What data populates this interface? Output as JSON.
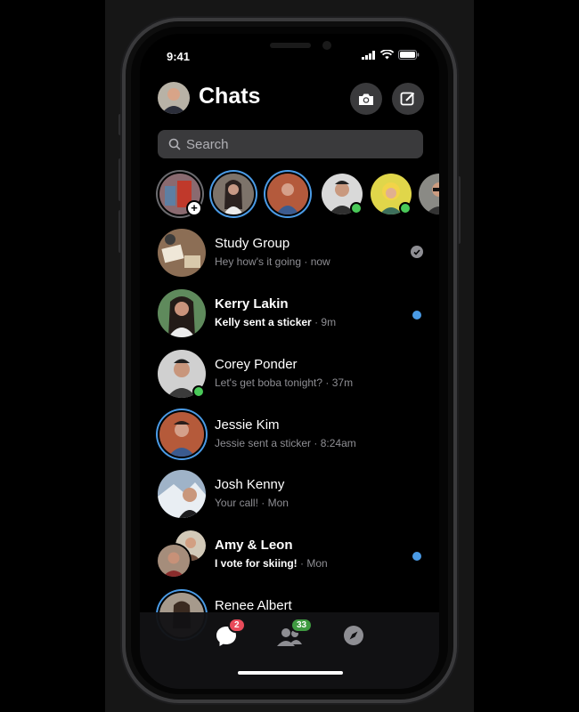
{
  "status_bar": {
    "time": "9:41"
  },
  "header": {
    "title": "Chats",
    "camera_icon": "camera-icon",
    "compose_icon": "compose-icon"
  },
  "search": {
    "placeholder": "Search"
  },
  "stories": [
    {
      "kind": "add-story",
      "ring": "none"
    },
    {
      "kind": "story",
      "ring": "blue"
    },
    {
      "kind": "story",
      "ring": "blue"
    },
    {
      "kind": "active",
      "online": true
    },
    {
      "kind": "active",
      "online": true
    },
    {
      "kind": "active",
      "online": false
    }
  ],
  "chats": [
    {
      "name": "Study Group",
      "preview": "Hey how's it going",
      "time": "now",
      "unread": false,
      "indicator": "read-check"
    },
    {
      "name": "Kerry Lakin",
      "preview": "Kelly sent a sticker",
      "time": "9m",
      "unread": true,
      "indicator": "unread-dot"
    },
    {
      "name": "Corey Ponder",
      "preview": "Let's get boba tonight?",
      "time": "37m",
      "unread": false,
      "online": true
    },
    {
      "name": "Jessie Kim",
      "preview": "Jessie sent a sticker",
      "time": "8:24am",
      "unread": false,
      "story_ring": true
    },
    {
      "name": "Josh Kenny",
      "preview": "Your call!",
      "time": "Mon",
      "unread": false
    },
    {
      "name": "Amy & Leon",
      "preview": "I vote for skiing!",
      "time": "Mon",
      "unread": true,
      "indicator": "unread-dot"
    },
    {
      "name": "Renee Albert",
      "preview": "",
      "time": "",
      "unread": false,
      "story_ring": true
    }
  ],
  "tabbar": {
    "chats_badge": "2",
    "people_badge": "33"
  },
  "colors": {
    "accent": "#4a9be6",
    "online": "#4ac959",
    "badge_red": "#e94b5a",
    "badge_green": "#3f9a41"
  },
  "sep": " · "
}
